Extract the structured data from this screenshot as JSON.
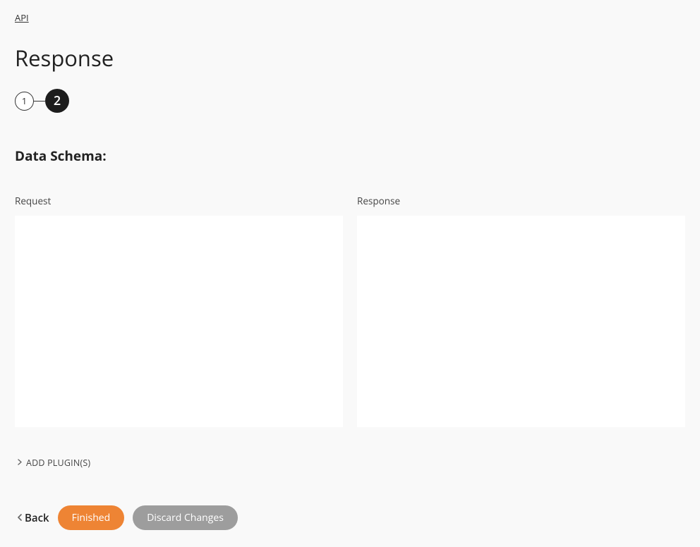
{
  "breadcrumb": {
    "api_label": "API"
  },
  "page": {
    "title": "Response"
  },
  "stepper": {
    "step1": "1",
    "step2": "2"
  },
  "section": {
    "data_schema_title": "Data Schema:"
  },
  "schema": {
    "request_label": "Request",
    "response_label": "Response",
    "request_value": "",
    "response_value": ""
  },
  "plugins": {
    "add_label": "ADD PLUGIN(S)"
  },
  "actions": {
    "back_label": "Back",
    "finished_label": "Finished",
    "discard_label": "Discard Changes"
  },
  "colors": {
    "primary": "#ee8434",
    "secondary": "#9d9d9d",
    "stepper_active": "#1d1d1d"
  }
}
